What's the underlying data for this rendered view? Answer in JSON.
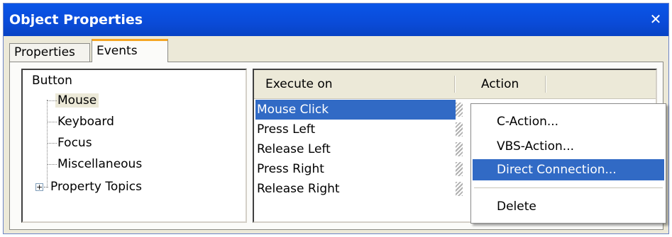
{
  "window": {
    "title": "Object Properties",
    "close_glyph": "✕"
  },
  "tabs": [
    {
      "label": "Properties",
      "active": false
    },
    {
      "label": "Events",
      "active": true
    }
  ],
  "tree": {
    "root": "Button",
    "children": [
      "Mouse",
      "Keyboard",
      "Focus",
      "Miscellaneous",
      "Property Topics"
    ],
    "selected": "Mouse",
    "expander_glyph": "+"
  },
  "grid": {
    "columns": [
      "Execute on",
      "Action"
    ],
    "rows": [
      "Mouse Click",
      "Press Left",
      "Release Left",
      "Press Right",
      "Release Right"
    ],
    "selected_row": "Mouse Click"
  },
  "context_menu": {
    "items": [
      "C-Action...",
      "VBS-Action...",
      "Direct Connection...",
      "Delete"
    ],
    "highlighted": "Direct Connection..."
  },
  "colors": {
    "titlebar": "#0a55e8",
    "selection": "#316ac5",
    "tab_accent": "#f5a623",
    "window_bg": "#ece9d8"
  }
}
